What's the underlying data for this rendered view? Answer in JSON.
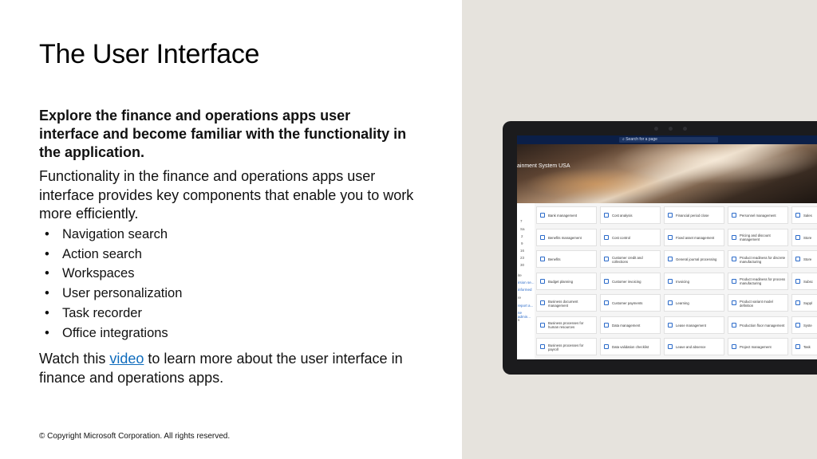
{
  "title": "The User Interface",
  "subtitle": "Explore the finance and operations apps user interface and become familiar with the functionality in the application.",
  "body": "Functionality in the finance and operations apps user interface provides key components that enable you to work more efficiently.",
  "bullets": [
    "Navigation search",
    "Action search",
    "Workspaces",
    "User personalization",
    "Task recorder",
    "Office integrations"
  ],
  "bullet_glyph": "•",
  "watch": {
    "before": "Watch this ",
    "link": "video",
    "after": " to learn more about the user interface in finance and operations apps."
  },
  "copyright": "© Copyright Microsoft Corporation. All rights reserved.",
  "tablet": {
    "search_placeholder": "Search for a page",
    "company_banner": "ainment System USA",
    "side_strip": [
      "7",
      "Sa",
      "2",
      "9",
      "16",
      "23",
      "30",
      "ite",
      "irsion se...",
      "informed",
      "re",
      "report a...",
      "ne admin...",
      "s"
    ],
    "columns": [
      [
        "Bank management",
        "Benefits management",
        "Benefits",
        "Budget planning",
        "Business document management",
        "Business processes for human resources",
        "Business processes for payroll"
      ],
      [
        "Cost analysis",
        "Cost control",
        "Customer credit and collections",
        "Customer invoicing",
        "Customer payments",
        "Data management",
        "Data validation checklist"
      ],
      [
        "Financial period close",
        "Fixed asset management",
        "General journal processing",
        "Invoicing",
        "Learning",
        "Lease management",
        "Leave and absence"
      ],
      [
        "Personnel management",
        "Pricing and discount management",
        "Product readiness for discrete manufacturing",
        "Product readiness for process manufacturing",
        "Product variant model definition",
        "Production floor management",
        "Project management"
      ],
      [
        "Sales",
        "Store",
        "Store",
        "Subsc",
        "Suppl",
        "Syste",
        "Task"
      ]
    ],
    "accent_color": "#2a6ac9",
    "navbar_color": "#0b1f48"
  }
}
